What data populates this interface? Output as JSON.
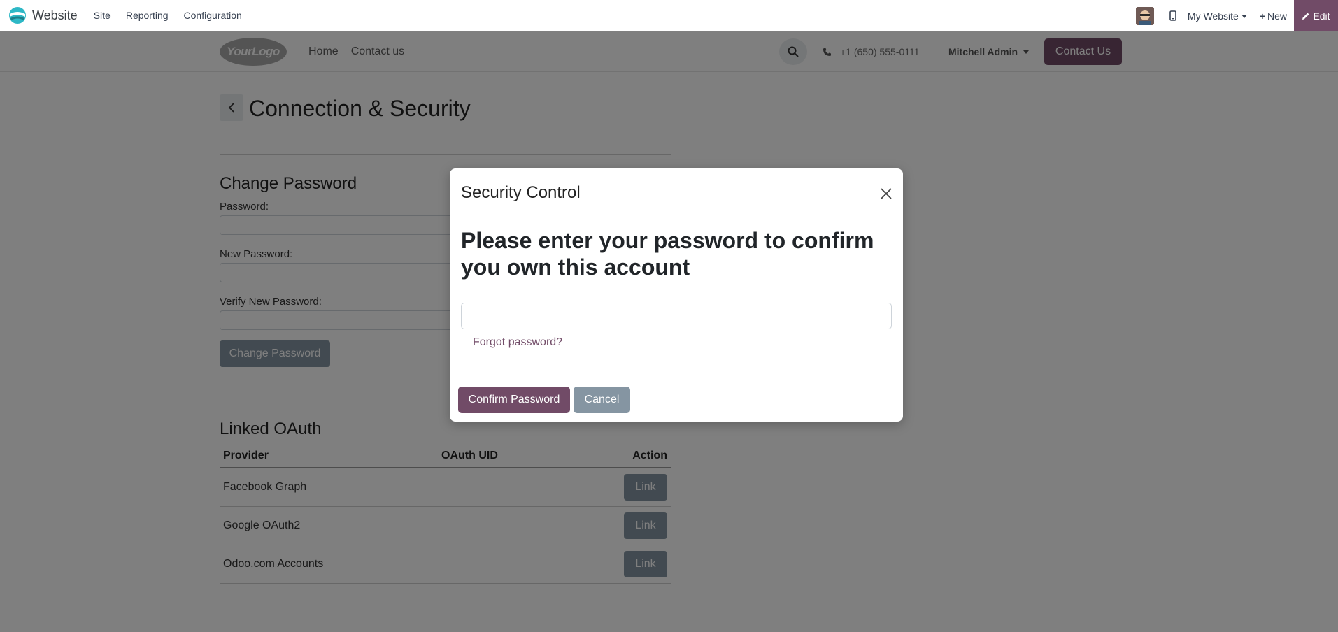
{
  "admin_bar": {
    "app_name": "Website",
    "menu": [
      "Site",
      "Reporting",
      "Configuration"
    ],
    "website_switcher": "My Website",
    "new_label": "New",
    "edit_label": "Edit",
    "accent_color": "#714b67"
  },
  "site_header": {
    "logo_text": "YourLogo",
    "nav": [
      "Home",
      "Contact us"
    ],
    "phone": "+1 (650) 555-0111",
    "user": "Mitchell Admin",
    "contact_button": "Contact Us"
  },
  "page": {
    "title": "Connection & Security",
    "change_password": {
      "heading": "Change Password",
      "fields": [
        "Password:",
        "New Password:",
        "Verify New Password:"
      ],
      "button": "Change Password"
    },
    "linked_oauth": {
      "heading": "Linked OAuth",
      "columns": [
        "Provider",
        "OAuth UID",
        "Action"
      ],
      "rows": [
        {
          "provider": "Facebook Graph",
          "uid": "",
          "action": "Link"
        },
        {
          "provider": "Google OAuth2",
          "uid": "",
          "action": "Link"
        },
        {
          "provider": "Odoo.com Accounts",
          "uid": "",
          "action": "Link"
        }
      ]
    }
  },
  "modal": {
    "title": "Security Control",
    "heading": "Please enter your password to confirm you own this account",
    "password_value": "",
    "forgot_link": "Forgot password?",
    "confirm_button": "Confirm Password",
    "cancel_button": "Cancel"
  }
}
